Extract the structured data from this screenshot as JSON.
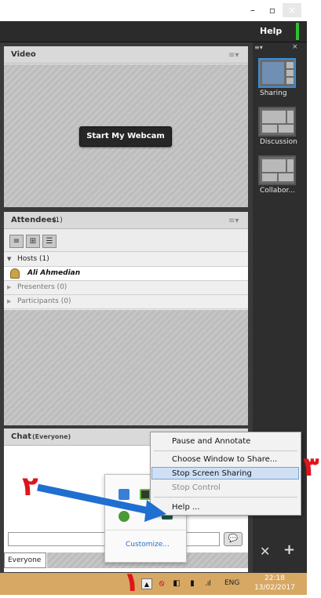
{
  "window": {
    "minimize": "–",
    "restore": "▫",
    "close": "×"
  },
  "menubar": {
    "help": "Help"
  },
  "video_pod": {
    "title": "Video",
    "menu_icon": "≡▾",
    "webcam_button": "Start My Webcam"
  },
  "attendees_pod": {
    "title": "Attendees",
    "count": "(1)",
    "menu_icon": "≡▾",
    "groups": {
      "hosts": "Hosts (1)",
      "host_name": "Ali Ahmedian",
      "presenters": "Presenters (0)",
      "participants": "Participants (0)"
    }
  },
  "chat_pod": {
    "title": "Chat",
    "scope": "(Everyone)",
    "send_icon": "💬",
    "tab": "Everyone"
  },
  "layouts": {
    "items": [
      {
        "label": "Sharing"
      },
      {
        "label": "Discussion"
      },
      {
        "label": "Collabor..."
      }
    ],
    "menu_icon": "≡▾",
    "close_icon": "×",
    "tools_icon": "✕",
    "add_icon": "+"
  },
  "context_menu": {
    "items": [
      {
        "label": "Pause and Annotate"
      },
      {
        "label": "Choose Window to Share..."
      },
      {
        "label": "Stop Screen Sharing"
      },
      {
        "label": "Stop Control"
      },
      {
        "label": "Help ..."
      }
    ]
  },
  "tray_popup": {
    "customize": "Customize..."
  },
  "taskbar": {
    "lang": "ENG",
    "time": "22:18",
    "date": "13/02/2017"
  },
  "annotations": {
    "one": "١",
    "two": "٢",
    "three": "٣"
  },
  "colors": {
    "accent": "#3a8fd8",
    "annotation": "#e0141c",
    "taskbar": "#d7a864",
    "highlight": "#cfe0f5"
  }
}
